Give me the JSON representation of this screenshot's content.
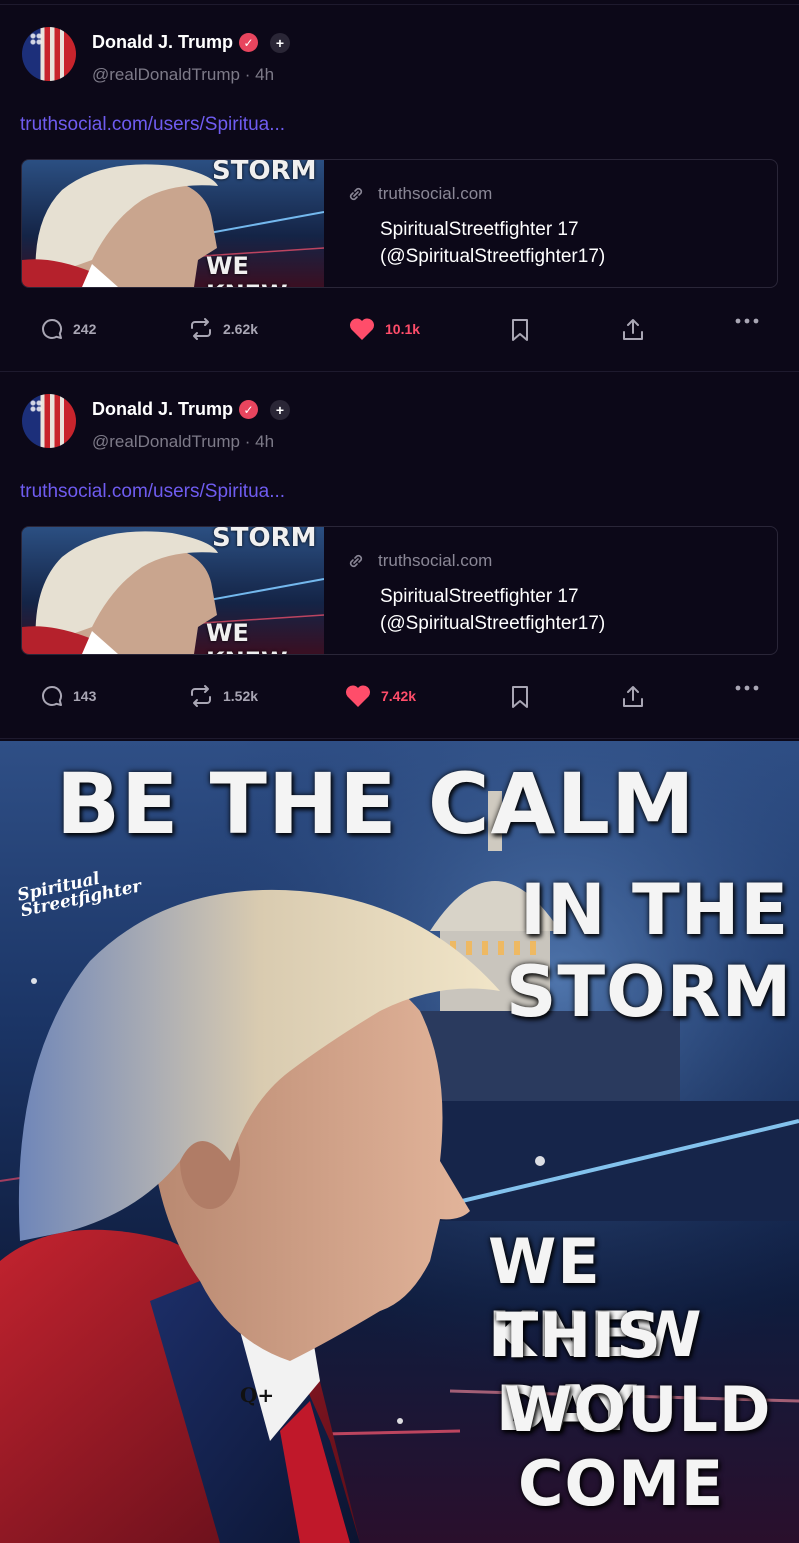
{
  "posts": [
    {
      "author_name": "Donald J. Trump",
      "verified_icon": "check-icon",
      "follow_icon": "plus-icon",
      "handle": "@realDonaldTrump",
      "separator": "·",
      "time": "4h",
      "link": "truthsocial.com/users/Spiritua...",
      "card": {
        "domain": "truthsocial.com",
        "title_line1": "SpiritualStreetfighter 17",
        "title_line2": "(@SpiritualStreetfighter17)",
        "thumb_text_top": "STORM",
        "thumb_text_bottom": "WE KNEW"
      },
      "replies": "242",
      "reposts": "2.62k",
      "likes": "10.1k"
    },
    {
      "author_name": "Donald J. Trump",
      "verified_icon": "check-icon",
      "follow_icon": "plus-icon",
      "handle": "@realDonaldTrump",
      "separator": "·",
      "time": "4h",
      "link": "truthsocial.com/users/Spiritua...",
      "card": {
        "domain": "truthsocial.com",
        "title_line1": "SpiritualStreetfighter 17",
        "title_line2": "(@SpiritualStreetfighter17)",
        "thumb_text_top": "STORM",
        "thumb_text_bottom": "WE KNEW"
      },
      "replies": "143",
      "reposts": "1.52k",
      "likes": "7.42k"
    }
  ],
  "poster": {
    "line1": "BE THE CALM",
    "line2": "IN THE",
    "line3": "STORM",
    "line4": "WE KNEW",
    "line5": "THIS DAY",
    "line6": "WOULD",
    "line7": "COME",
    "watermark_line1": "Spiritual",
    "watermark_line2": "Streetfighter",
    "pin_text": "Q+"
  },
  "colors": {
    "background": "#0c0818",
    "link": "#6f5cf0",
    "like": "#ff4d6a",
    "verified": "#e8455e",
    "muted": "#7d7a88"
  }
}
